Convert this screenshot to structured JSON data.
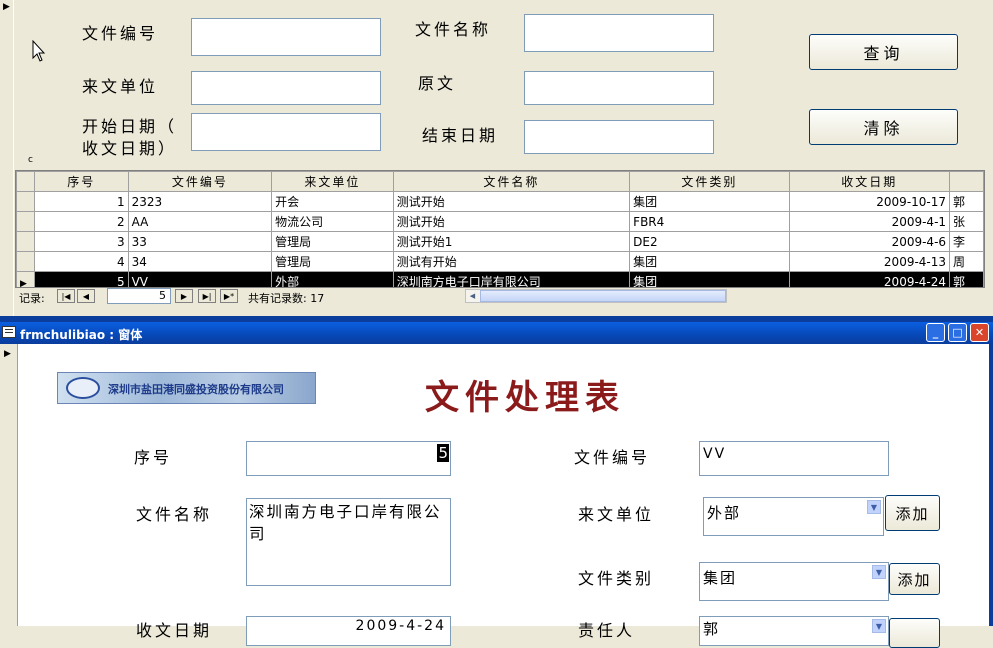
{
  "search": {
    "doc_number_label": "文件编号",
    "doc_name_label": "文件名称",
    "from_unit_label": "来文单位",
    "original_label": "原文",
    "start_date_label_1": "开始日期（",
    "start_date_label_2": "收文日期）",
    "end_date_label": "结束日期",
    "query_button": "查询",
    "clear_button": "清除",
    "small_marker": "c"
  },
  "grid": {
    "columns": [
      "序号",
      "文件编号",
      "来文单位",
      "文件名称",
      "文件类别",
      "收文日期",
      ""
    ],
    "rows": [
      [
        "1",
        "2323",
        "开会",
        "测试开始",
        "集团",
        "2009-10-17",
        "郭"
      ],
      [
        "2",
        "AA",
        "物流公司",
        "测试开始",
        "FBR4",
        "2009-4-1",
        "张"
      ],
      [
        "3",
        "33",
        "管理局",
        "测试开始1",
        "DE2",
        "2009-4-6",
        "李"
      ],
      [
        "4",
        "34",
        "管理局",
        "测试有开始",
        "集团",
        "2009-4-13",
        "周"
      ],
      [
        "5",
        "VV",
        "外部",
        "深圳南方电子口岸有限公司",
        "集团",
        "2009-4-24",
        "郭"
      ]
    ],
    "current_row": 4
  },
  "navigation": {
    "record_label": "记录:",
    "current_record": "5",
    "total_label": "共有记录数: 17"
  },
  "window": {
    "title": "frmchulibiao : 窗体",
    "minimize": "_",
    "maximize": "□",
    "close": "✕"
  },
  "form": {
    "logo_text": "深圳市盐田港同盛投资股份有限公司",
    "title": "文件处理表",
    "seq_label": "序号",
    "seq_value": "5",
    "doc_number_label": "文件编号",
    "doc_number_value": "VV",
    "doc_name_label": "文件名称",
    "doc_name_value": "深圳南方电子口岸有限公司",
    "from_unit_label": "来文单位",
    "from_unit_value": "外部",
    "category_label": "文件类别",
    "category_value": "集团",
    "add_button_1": "添加",
    "add_button_2": "添加",
    "received_date_label": "收文日期",
    "received_date_value": "2009-4-24",
    "responsible_label": "责任人",
    "responsible_value": "郭"
  },
  "colors": {
    "title_red": "#8b1a1a",
    "titlebar_blue": "#0a4fd0",
    "close_red": "#d9462b"
  }
}
